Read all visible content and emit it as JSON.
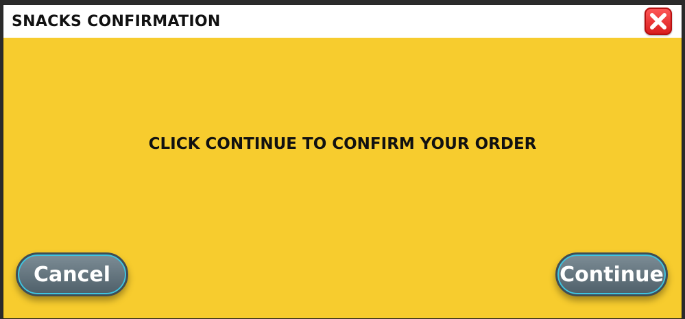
{
  "dialog": {
    "title": "SNACKS CONFIRMATION",
    "message": "CLICK CONTINUE TO CONFIRM YOUR ORDER",
    "cancel_label": "Cancel",
    "continue_label": "Continue",
    "close_icon": "close-icon"
  },
  "colors": {
    "background": "#f7cc2e",
    "titlebar": "#ffffff",
    "close_button": "#e12424",
    "button": "#5e6f79",
    "button_outline": "#3ec4e0"
  }
}
